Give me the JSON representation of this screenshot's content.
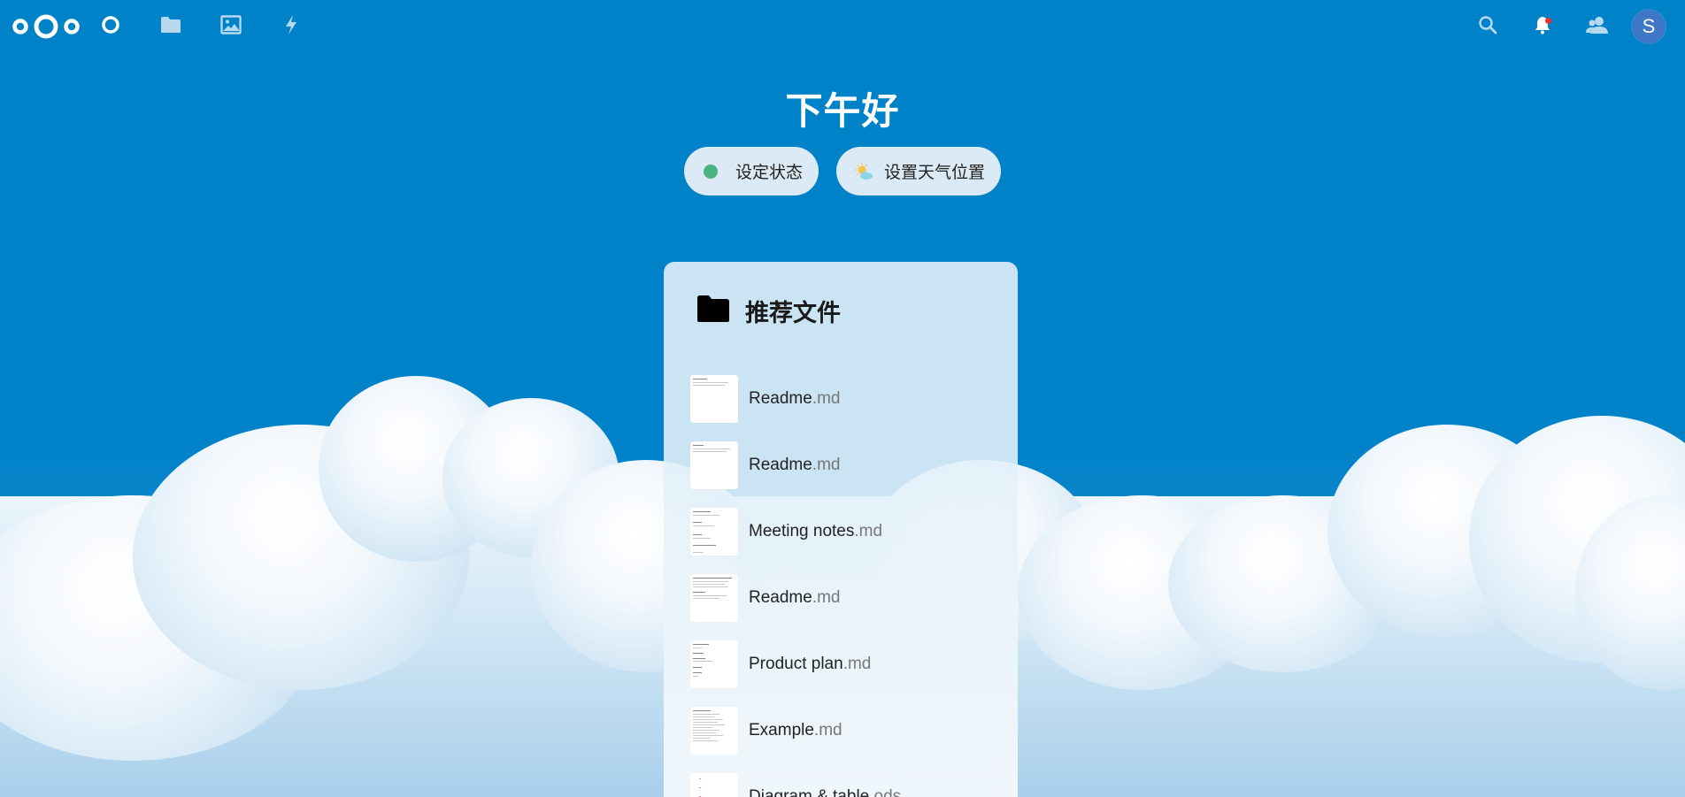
{
  "header": {
    "nav": [
      {
        "name": "dashboard",
        "icon": "dashboard-circle-icon"
      },
      {
        "name": "files",
        "icon": "folder-icon"
      },
      {
        "name": "photos",
        "icon": "image-icon"
      },
      {
        "name": "activity",
        "icon": "lightning-icon"
      }
    ],
    "right": {
      "search_icon": "search-icon",
      "notifications_icon": "bell-icon",
      "contacts_icon": "contacts-icon",
      "avatar_initial": "S"
    }
  },
  "greeting": "下午好",
  "status": {
    "set_status_label": "设定状态",
    "weather_label": "设置天气位置"
  },
  "panel": {
    "title": "推荐文件",
    "files": [
      {
        "name": "Readme",
        "ext": ".md"
      },
      {
        "name": "Readme",
        "ext": ".md"
      },
      {
        "name": "Meeting notes",
        "ext": ".md"
      },
      {
        "name": "Readme",
        "ext": ".md"
      },
      {
        "name": "Product plan",
        "ext": ".md"
      },
      {
        "name": "Example",
        "ext": ".md"
      },
      {
        "name": "Diagram & table",
        "ext": ".ods"
      }
    ]
  },
  "colors": {
    "primary": "#0082c9",
    "status_online": "#49b382",
    "notification_dot": "#e9322d",
    "avatar": "#3e77c6"
  }
}
